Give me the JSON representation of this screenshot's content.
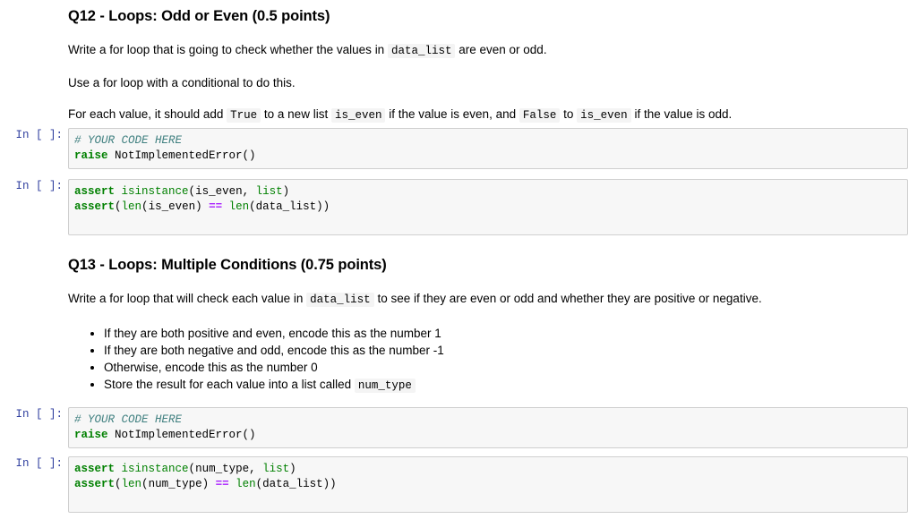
{
  "notebook": {
    "cells": [
      {
        "type": "markdown",
        "name": "q12",
        "heading": "Q12 - Loops: Odd or Even (0.5 points)",
        "paragraph_1": {
          "before": "Write a for loop that is going to check whether the values in",
          "code_1": "data_list",
          "after": "are even or odd."
        },
        "paragraph_2": "Use a for loop with a conditional to do this.",
        "paragraph_3": {
          "seg_1": "For each value, it should add",
          "code_1": "True",
          "seg_2": "to a new list",
          "code_2": "is_even",
          "seg_3": "if the value is even, and",
          "code_3": "False",
          "seg_4": "to",
          "code_4": "is_even",
          "seg_5": "if the value is odd."
        }
      },
      {
        "type": "code",
        "name": "q12-answer",
        "prompt": "In [ ]:",
        "line_1_comment": "# YOUR CODE HERE",
        "line_2_keyword": "raise",
        "line_2_rest": " NotImplementedError()"
      },
      {
        "type": "code",
        "name": "q12-test",
        "prompt": "In [ ]:",
        "line_1": {
          "kw": "assert",
          "sp": " ",
          "builtin": "isinstance",
          "open": "(",
          "arg1": "is_even",
          "comma": ", ",
          "type": "list",
          "close": ")"
        },
        "line_2": {
          "kw": "assert",
          "open": "(",
          "len1": "len",
          "p1": "(",
          "arg1": "is_even",
          "p2": ")",
          "op": " == ",
          "len2": "len",
          "p3": "(",
          "arg2": "data_list",
          "p4": "))"
        }
      },
      {
        "type": "markdown",
        "name": "q13",
        "heading": "Q13 - Loops: Multiple Conditions (0.75 points)",
        "paragraph_1": {
          "before": "Write a for loop that will check each value in",
          "code_1": "data_list",
          "after": "to see if they are even or odd and whether they are positive or negative."
        },
        "bullets": [
          {
            "text": "If they are both positive and even, encode this as the number 1"
          },
          {
            "text": "If they are both negative and odd, encode this as the number -1"
          },
          {
            "text": "Otherwise, encode this as the number 0"
          },
          {
            "text_before": "Store the result for each value into a list called",
            "code": "num_type"
          }
        ]
      },
      {
        "type": "code",
        "name": "q13-answer",
        "prompt": "In [ ]:",
        "line_1_comment": "# YOUR CODE HERE",
        "line_2_keyword": "raise",
        "line_2_rest": " NotImplementedError()"
      },
      {
        "type": "code",
        "name": "q13-test",
        "prompt": "In [ ]:",
        "line_1": {
          "kw": "assert",
          "sp": " ",
          "builtin": "isinstance",
          "open": "(",
          "arg1": "num_type",
          "comma": ", ",
          "type": "list",
          "close": ")"
        },
        "line_2": {
          "kw": "assert",
          "open": "(",
          "len1": "len",
          "p1": "(",
          "arg1": "num_type",
          "p2": ")",
          "op": " == ",
          "len2": "len",
          "p3": "(",
          "arg2": "data_list",
          "p4": "))"
        }
      }
    ]
  },
  "colors": {
    "cell_background": "#f7f7f7",
    "cell_border": "#cfcfcf",
    "prompt": "#303f9f",
    "comment": "#408080",
    "keyword": "#008000",
    "builtin": "#008000",
    "operator": "#aa22ff",
    "inline_code_background": "#f4f4f4",
    "page_background": "#ffffff"
  }
}
